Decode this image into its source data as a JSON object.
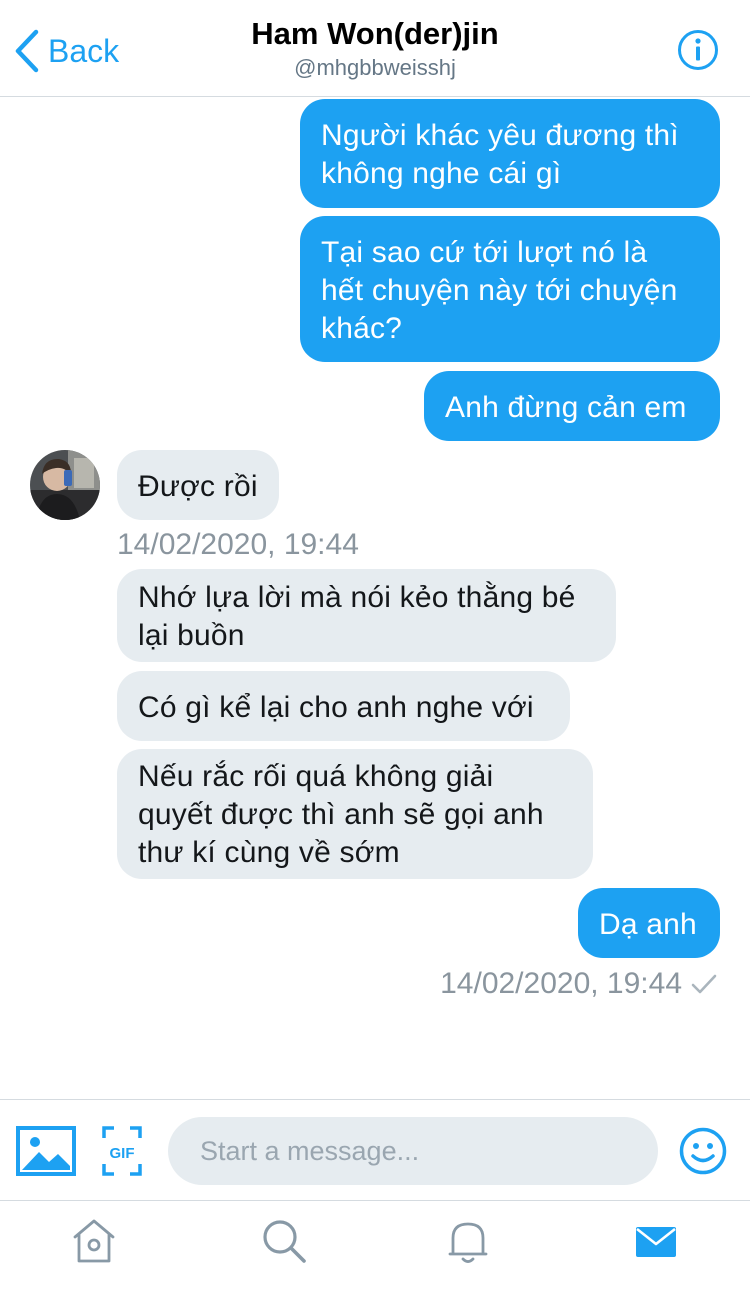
{
  "header": {
    "back_label": "Back",
    "title": "Ham Won(der)jin",
    "handle": "@mhgbbweisshj"
  },
  "messages": [
    {
      "direction": "outgoing",
      "text": "Người khác yêu đương thì\nkhông nghe cái gì"
    },
    {
      "direction": "outgoing",
      "text": "Tại sao cứ tới lượt nó là\nhết chuyện này tới chuyện\nkhác?"
    },
    {
      "direction": "outgoing",
      "text": "Anh đừng cản em"
    },
    {
      "direction": "incoming",
      "text": "Được rồi"
    },
    {
      "direction": "incoming",
      "text": "Nhớ lựa lời mà nói kẻo thằng bé\nlại buồn"
    },
    {
      "direction": "incoming",
      "text": "Có gì kể lại cho anh nghe với"
    },
    {
      "direction": "incoming",
      "text": "Nếu rắc rối quá không giải\nquyết được thì anh sẽ gọi anh\nthư kí cùng về sớm"
    },
    {
      "direction": "outgoing",
      "text": "Dạ anh"
    }
  ],
  "timestamps": {
    "incoming": "14/02/2020, 19:44",
    "outgoing": "14/02/2020, 19:44"
  },
  "composer": {
    "placeholder": "Start a message...",
    "gif_label": "GIF"
  },
  "tabbar": {
    "items": [
      "home",
      "search",
      "notifications",
      "messages"
    ],
    "active": "messages"
  },
  "colors": {
    "accent": "#1da1f2",
    "incoming_bubble": "#e6ecf0",
    "muted_text": "#8a959e",
    "tab_inactive": "#8899a6"
  }
}
